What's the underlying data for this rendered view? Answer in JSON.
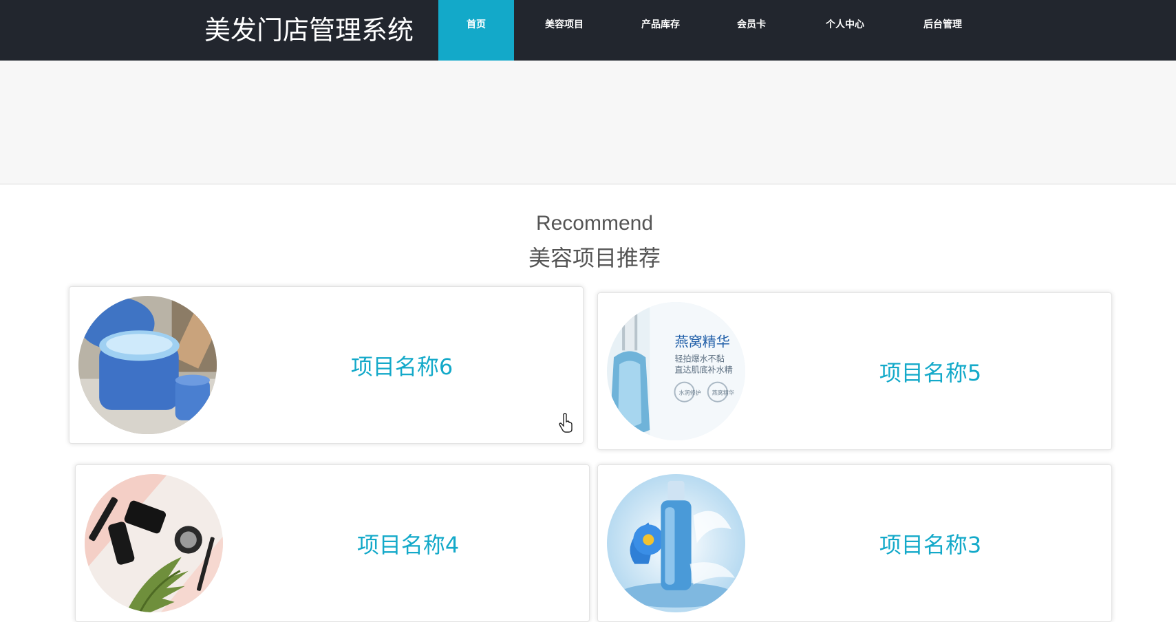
{
  "brand": {
    "title": "美发门店管理系统"
  },
  "nav": {
    "items": [
      {
        "label": "首页",
        "active": true
      },
      {
        "label": "美容项目"
      },
      {
        "label": "产品库存"
      },
      {
        "label": "会员卡"
      },
      {
        "label": "个人中心"
      },
      {
        "label": "后台管理"
      }
    ]
  },
  "section": {
    "title_en": "Recommend",
    "title_zh": "美容项目推荐"
  },
  "cards": [
    {
      "name": "项目名称6",
      "image": "blue-cream-jar-image"
    },
    {
      "name": "项目名称5",
      "image": "serum-bottle-ad-image",
      "image_text": [
        "燕窝精华",
        "轻拍爆水不黏",
        "直达肌底补水精",
        "水润修护",
        "燕窝精华"
      ]
    },
    {
      "name": "项目名称4",
      "image": "makeup-tools-flatlay-image"
    },
    {
      "name": "项目名称3",
      "image": "water-splash-bottle-image"
    }
  ],
  "colors": {
    "navbar": "#22262e",
    "accent": "#13a9c9",
    "banner": "#f7f7f7",
    "heading": "#555555"
  }
}
